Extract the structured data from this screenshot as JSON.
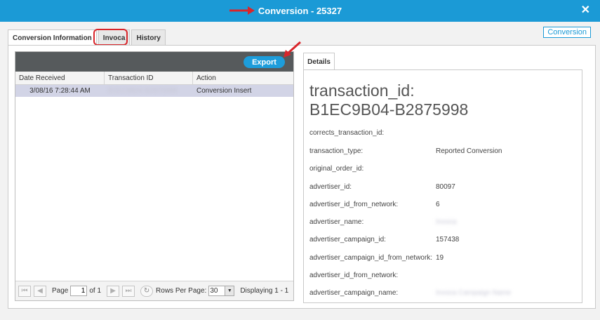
{
  "window": {
    "title": "Conversion - 25327",
    "close_glyph": "✕"
  },
  "tabs": [
    "Conversion Information",
    "Invoca",
    "History"
  ],
  "top_right_link": "Conversion",
  "grid": {
    "export_label": "Export",
    "columns": [
      "Date Received",
      "Transaction ID",
      "Action"
    ],
    "rows": [
      {
        "date": "3/08/16 7:28:44 AM",
        "transaction_id": "B1EC9B04-B2875998",
        "action": "Conversion Insert"
      }
    ]
  },
  "pager": {
    "page_label": "Page",
    "page_value": "1",
    "of_label": "of 1",
    "rows_per_page_label": "Rows Per Page:",
    "rows_per_page_value": "30",
    "displaying": "Displaying 1 - 1"
  },
  "details": {
    "tab_label": "Details",
    "title_line1": "transaction_id:",
    "title_line2": "B1EC9B04-B2875998",
    "fields": [
      {
        "key": "corrects_transaction_id:",
        "value": ""
      },
      {
        "key": "transaction_type:",
        "value": "Reported Conversion"
      },
      {
        "key": "original_order_id:",
        "value": ""
      },
      {
        "key": "advertiser_id:",
        "value": "80097"
      },
      {
        "key": "advertiser_id_from_network:",
        "value": "6"
      },
      {
        "key": "advertiser_name:",
        "value": "Invoca"
      },
      {
        "key": "advertiser_campaign_id:",
        "value": "157438"
      },
      {
        "key": "advertiser_campaign_id_from_network:",
        "value": "19"
      },
      {
        "key": "advertiser_id_from_network:",
        "value": ""
      },
      {
        "key": "advertiser_campaign_name:",
        "value": "Invoca Campaign Name"
      }
    ]
  },
  "colors": {
    "titlebar": "#1b9ad6",
    "grid_toolbar": "#565a5c",
    "selected_row": "#d2d4e6",
    "annotation_red": "#d9252a"
  }
}
